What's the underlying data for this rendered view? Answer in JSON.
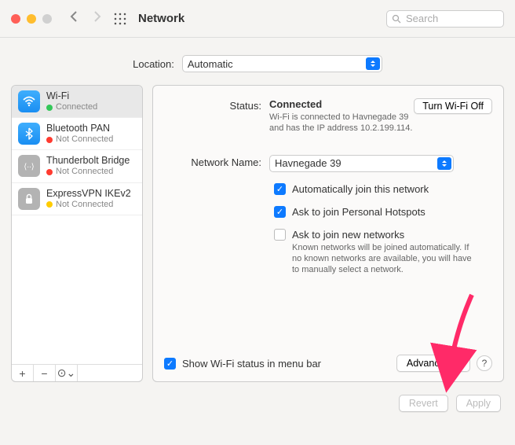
{
  "toolbar": {
    "title": "Network",
    "search_placeholder": "Search"
  },
  "location": {
    "label": "Location:",
    "value": "Automatic"
  },
  "sidebar": {
    "items": [
      {
        "name": "Wi-Fi",
        "status": "Connected",
        "icon": "wifi-icon",
        "dot": "green",
        "selected": true
      },
      {
        "name": "Bluetooth PAN",
        "status": "Not Connected",
        "icon": "bluetooth-icon",
        "dot": "red",
        "selected": false
      },
      {
        "name": "Thunderbolt Bridge",
        "status": "Not Connected",
        "icon": "thunderbolt-icon",
        "dot": "red",
        "selected": false
      },
      {
        "name": "ExpressVPN IKEv2",
        "status": "Not Connected",
        "icon": "vpn-icon",
        "dot": "yellow",
        "selected": false
      }
    ],
    "add_label": "+",
    "remove_label": "−",
    "actions_label": "⊙⌄"
  },
  "detail": {
    "status_label": "Status:",
    "status_value": "Connected",
    "wifi_toggle": "Turn Wi-Fi Off",
    "status_desc": "Wi-Fi is connected to Havnegade 39 and has the IP address 10.2.199.114.",
    "network_name_label": "Network Name:",
    "network_name_value": "Havnegade 39",
    "auto_join_label": "Automatically join this network",
    "ask_hotspot_label": "Ask to join Personal Hotspots",
    "ask_new_label": "Ask to join new networks",
    "ask_new_desc": "Known networks will be joined automatically. If no known networks are available, you will have to manually select a network.",
    "show_status_label": "Show Wi-Fi status in menu bar",
    "advanced_label": "Advanced…",
    "help_label": "?"
  },
  "footer": {
    "revert": "Revert",
    "apply": "Apply"
  }
}
